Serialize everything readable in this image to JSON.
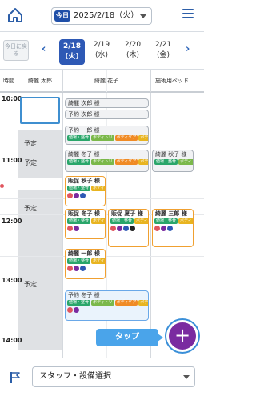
{
  "header": {
    "today_badge": "今日",
    "date_label": "2025/2/18（火）"
  },
  "datebar": {
    "back_today": "今日に戻る",
    "prev_arrow": "‹",
    "next_arrow": "›",
    "days": [
      {
        "date": "2/18",
        "dow": "(火)",
        "selected": true
      },
      {
        "date": "2/19",
        "dow": "(水)",
        "selected": false
      },
      {
        "date": "2/20",
        "dow": "(木)",
        "selected": false
      },
      {
        "date": "2/21",
        "dow": "(金)",
        "selected": false
      }
    ]
  },
  "table": {
    "columns": [
      "時間",
      "綺麗 太郎",
      "綺麗 花子",
      "施術用ベッド"
    ],
    "times": [
      "10:00",
      "11:00",
      "12:00",
      "13:00",
      "14:00"
    ],
    "yotei": "予定",
    "appointments": {
      "a1": "綺麗 次郎 様",
      "a2": "予約 次郎 様",
      "a3": "予約 一郎 様",
      "a4": "綺麗 冬子 様",
      "a5": "綺麗 秋子 様",
      "a6": "販促 秋子 様",
      "a7": "販促 冬子 様",
      "a8": "販促 夏子 様",
      "a9": "綺麗 三郎 様",
      "a10": "綺麗 一郎 様",
      "a11": "予約 冬子 様"
    },
    "tags": {
      "heal": "値場・整骨",
      "bot": "ボディトリ",
      "bodyc": "ボディケア",
      "bodyt": "ボディ"
    }
  },
  "tap_tooltip": "タップ",
  "fab_label": "+",
  "footer": {
    "staff_select": "スタッフ・設備選択"
  },
  "colors": {
    "accent_blue": "#2e59b5",
    "fab_purple": "#7a2ba0",
    "orange_border": "#f0a030",
    "now_line": "#e0555e"
  }
}
